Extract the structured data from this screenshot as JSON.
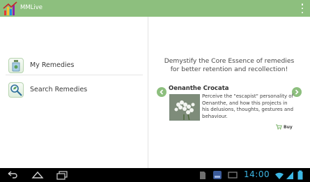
{
  "app": {
    "title": "MMLive",
    "accent_color": "#8dbf7e"
  },
  "menu": {
    "items": [
      {
        "label": "My Remedies",
        "icon": "remedy-bottle-icon"
      },
      {
        "label": "Search Remedies",
        "icon": "magnifier-leaf-icon"
      }
    ]
  },
  "promo": {
    "tagline_line1": "Demystify the Core Essence of remedies",
    "tagline_line2": "for better retention and recollection!"
  },
  "remedy": {
    "name": "Oenanthe Crocata",
    "desc_lines": [
      "Perceive the \"escapist\" personality of",
      "Oenanthe, and how this projects in",
      "his delusions, thoughts, gestures and",
      "behaviour."
    ],
    "buy_label": "Buy"
  },
  "system": {
    "clock": "14:00",
    "clock_color": "#3db7e4"
  }
}
